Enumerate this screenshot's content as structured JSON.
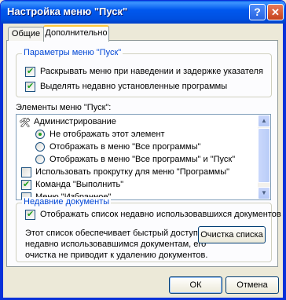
{
  "window": {
    "title": "Настройка меню \"Пуск\"",
    "help_glyph": "?",
    "close_glyph": "✕"
  },
  "tabs": [
    {
      "label": "Общие",
      "active": false
    },
    {
      "label": "Дополнительно",
      "active": true
    }
  ],
  "start_menu_params": {
    "title": "Параметры меню \"Пуск\"",
    "items": [
      {
        "label": "Раскрывать меню при наведении и задержке указателя",
        "checked": true
      },
      {
        "label": "Выделять недавно установленные программы",
        "checked": true
      }
    ]
  },
  "start_menu_items": {
    "label": "Элементы меню \"Пуск\":",
    "list": {
      "admin_label": "Администрирование",
      "options": [
        {
          "label": "Не отображать этот элемент",
          "checked": true
        },
        {
          "label": "Отображать в меню \"Все программы\"",
          "checked": false
        },
        {
          "label": "Отображать в меню \"Все программы\" и \"Пуск\"",
          "checked": false
        }
      ],
      "checks": [
        {
          "label": "Использовать прокрутку для меню \"Программы\"",
          "checked": false
        },
        {
          "label": "Команда \"Выполнить\"",
          "checked": true
        },
        {
          "label": "Меню \"Избранное\"",
          "checked": false
        }
      ]
    }
  },
  "recent_docs": {
    "title": "Недавние документы",
    "checkbox_label": "Отображать список недавно использовавшихся документов",
    "checked": true,
    "description": [
      "Этот список обеспечивает быстрый доступ к",
      "недавно использовавшимся документам, его",
      "очистка не приводит к удалению документов."
    ],
    "clear_button": "Очистка списка"
  },
  "footer": {
    "ok": "ОК",
    "cancel": "Отмена"
  },
  "colors": {
    "accent": "#0046d5",
    "check": "#21a121",
    "titlebar": "#0058ee"
  }
}
